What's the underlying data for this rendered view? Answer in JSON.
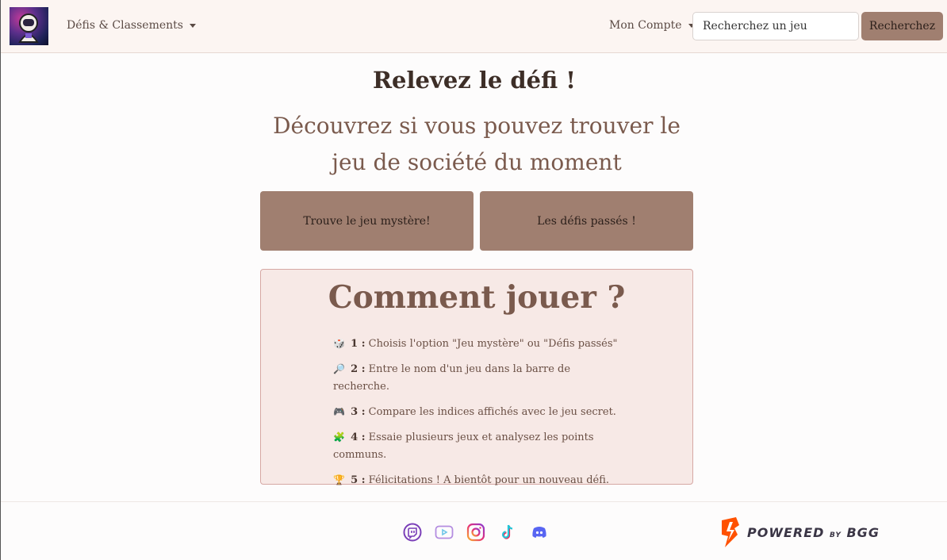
{
  "nav": {
    "defis_label": "Défis & Classements",
    "compte_label": "Mon Compte",
    "search_placeholder": "Recherchez un jeu",
    "search_button": "Recherchez"
  },
  "main": {
    "title": "Relevez le défi !",
    "subtitle": "Découvrez si vous pouvez trouver le jeu de société du moment",
    "btn_mystere": "Trouve le jeu mystère!",
    "btn_passes": "Les défis passés !"
  },
  "howto": {
    "title": "Comment jouer ?",
    "steps": [
      {
        "emoji": "🎲",
        "num": "1 :",
        "text": "Choisis l'option \"Jeu mystère\" ou \"Défis passés\""
      },
      {
        "emoji": "🔎",
        "num": "2 :",
        "text": "Entre le nom d'un jeu dans la barre de recherche."
      },
      {
        "emoji": "🎮",
        "num": "3 :",
        "text": "Compare les indices affichés avec le jeu secret."
      },
      {
        "emoji": "🧩",
        "num": "4 :",
        "text": "Essaie plusieurs jeux et analysez les points communs."
      },
      {
        "emoji": "🏆",
        "num": "5 :",
        "text": "Félicitations ! A bientôt pour un nouveau défi."
      }
    ]
  },
  "footer": {
    "socials": [
      "twitch-icon",
      "youtube-icon",
      "instagram-icon",
      "tiktok-icon",
      "discord-icon"
    ],
    "powered_prefix": "POWERED",
    "powered_by": "BY",
    "powered_brand": "BGG"
  },
  "colors": {
    "accent": "#a07f70",
    "howto_bg": "#f7e9e6",
    "nav_bg": "#fcf5f2"
  }
}
